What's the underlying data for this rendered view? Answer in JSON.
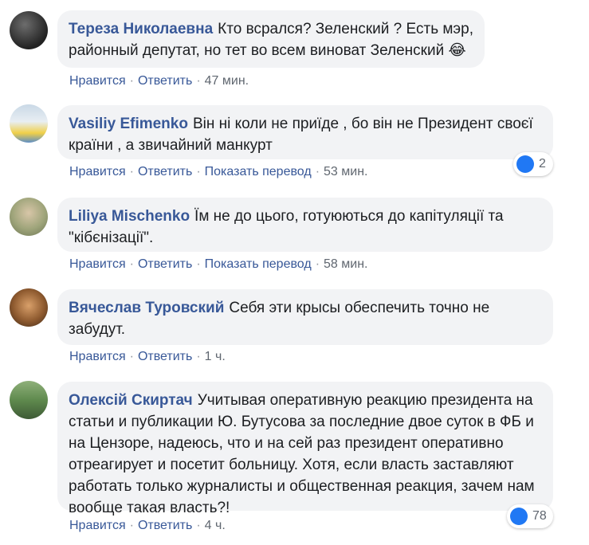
{
  "comments": [
    {
      "author": "Тереза Николаевна",
      "text": "Кто всрался? Зеленский ? Есть мэр, районный депутат, но тет во всем виноват Зеленский 😂",
      "actions": {
        "like": "Нравится",
        "reply": "Ответить",
        "time": "47 мин."
      }
    },
    {
      "author": "Vasiliy Efimenko",
      "text": "Він ні коли не приїде , бо він не Президент своєї країни , а звичайний манкурт",
      "actions": {
        "like": "Нравится",
        "reply": "Ответить",
        "translate": "Показать перевод",
        "time": "53 мин."
      },
      "reactions": {
        "count": "2"
      }
    },
    {
      "author": "Liliya Mischenko",
      "text": "Їм не до цього, готуюються до капітуляції та \"кібєнізації\".",
      "actions": {
        "like": "Нравится",
        "reply": "Ответить",
        "translate": "Показать перевод",
        "time": "58 мин."
      }
    },
    {
      "author": "Вячеслав Туровский",
      "text": "Себя эти крысы обеспечить точно не забудут.",
      "actions": {
        "like": "Нравится",
        "reply": "Ответить",
        "time": "1 ч."
      }
    },
    {
      "author": "Олексій Скиртач",
      "text": "Учитывая оперативную реакцию президента на статьи и публикации Ю. Бутусова за последние двое суток в ФБ и на Цензоре, надеюсь, что и на сей раз президент оперативно отреагирует и посетит больницу. Хотя, если власть заставляют работать только журналисты и общественная реакция, зачем нам вообще такая власть?!",
      "actions": {
        "like": "Нравится",
        "reply": "Ответить",
        "time": "4 ч."
      },
      "reactions": {
        "count": "78"
      }
    }
  ],
  "colors": {
    "link": "#385898",
    "bubble": "#f2f3f5",
    "meta": "#606770",
    "like": "#2078f4"
  },
  "icons": {
    "like": "like-icon"
  }
}
